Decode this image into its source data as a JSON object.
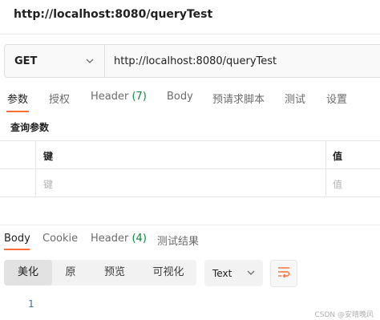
{
  "request": {
    "title": "http://localhost:8080/queryTest",
    "method": "GET",
    "url": "http://localhost:8080/queryTest"
  },
  "request_tabs": [
    {
      "label": "参数"
    },
    {
      "label": "授权"
    },
    {
      "label": "Header",
      "count": "(7)"
    },
    {
      "label": "Body"
    },
    {
      "label": "预请求脚本"
    },
    {
      "label": "测试"
    },
    {
      "label": "设置"
    }
  ],
  "params": {
    "section_label": "查询参数",
    "header_key": "键",
    "header_value": "值",
    "key_placeholder": "键",
    "value_placeholder": "值"
  },
  "response_tabs": [
    {
      "label": "Body"
    },
    {
      "label": "Cookie"
    },
    {
      "label": "Header",
      "count": "(4)"
    },
    {
      "label": "测试结果"
    }
  ],
  "view_modes": [
    "美化",
    "原",
    "预览",
    "可视化"
  ],
  "format": "Text",
  "line_number": "1",
  "watermark": "CSDN @安晴晚风",
  "colors": {
    "accent": "#ff6c37",
    "count_green": "#0b8a3f"
  },
  "icons": {
    "method_dropdown": "chevron-down-icon",
    "format_dropdown": "chevron-down-icon",
    "wrap": "wrap-lines-icon"
  }
}
